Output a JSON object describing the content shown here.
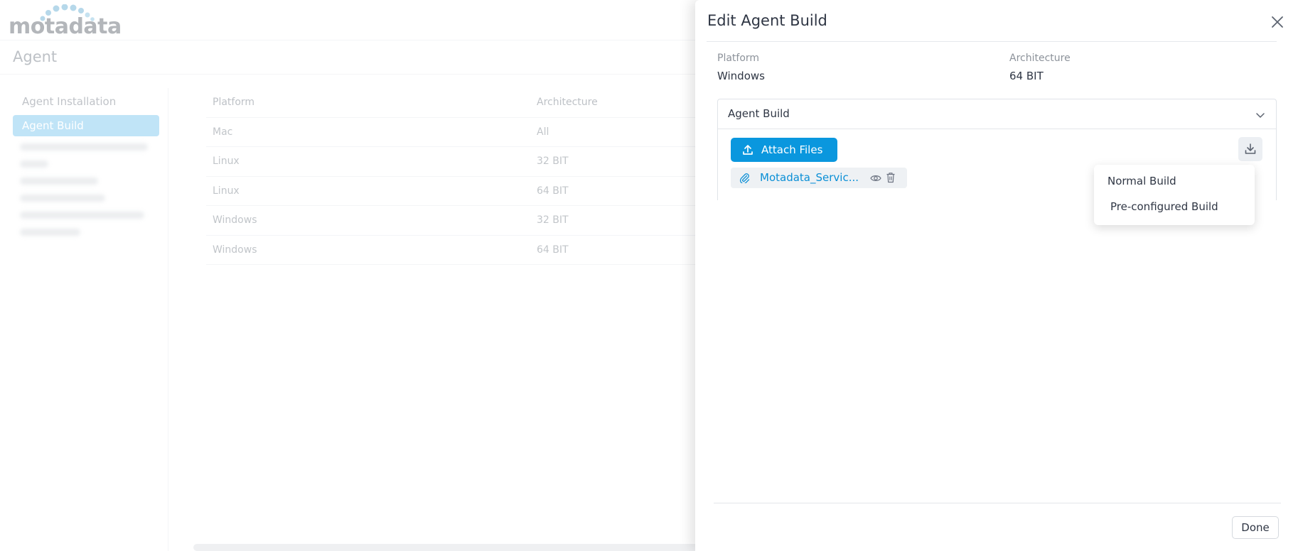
{
  "app": {
    "logo_text": "motadata",
    "page_title": "Agent",
    "nav": {
      "items": [
        {
          "label": "Agent Installation",
          "active": false
        },
        {
          "label": "Agent Build",
          "active": true
        }
      ]
    },
    "table": {
      "headers": [
        "Platform",
        "Architecture"
      ],
      "rows": [
        [
          "Mac",
          "All"
        ],
        [
          "Linux",
          "32 BIT"
        ],
        [
          "Linux",
          "64 BIT"
        ],
        [
          "Windows",
          "32 BIT"
        ],
        [
          "Windows",
          "64 BIT"
        ]
      ]
    }
  },
  "drawer": {
    "title": "Edit Agent Build",
    "platform_label": "Platform",
    "platform_value": "Windows",
    "architecture_label": "Architecture",
    "architecture_value": "64 BIT",
    "accordion_title": "Agent Build",
    "attach_label": "Attach Files",
    "file_name": "Motadata_Servic...",
    "dropdown": {
      "items": [
        "Normal Build",
        "Pre-configured Build"
      ]
    },
    "done_label": "Done"
  },
  "colors": {
    "accent": "#0a97de",
    "nav_active": "#9fd6f3",
    "logo_dots": "#8fc3df"
  }
}
